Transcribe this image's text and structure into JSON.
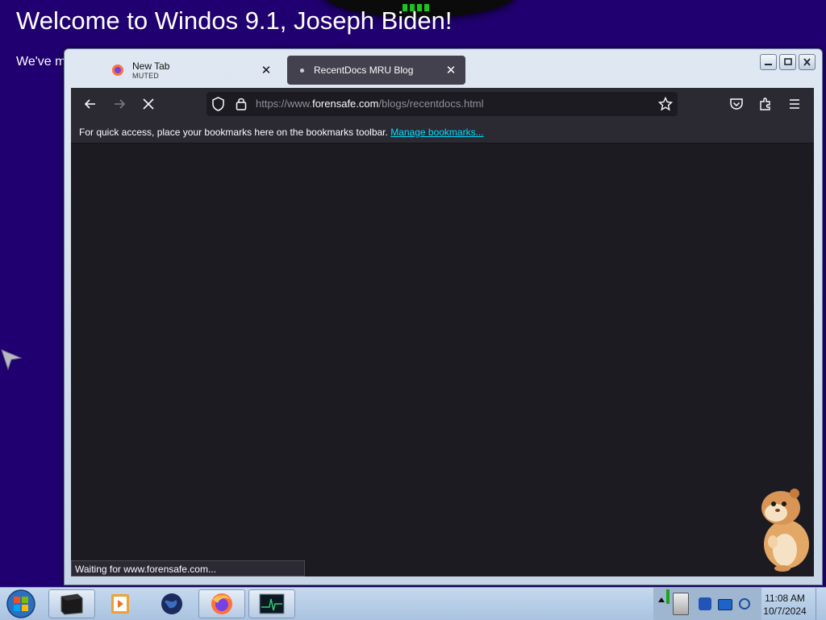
{
  "desktop": {
    "welcome_title": "Welcome to Windos 9.1, Joseph Biden!",
    "subtext": "We've m"
  },
  "browser": {
    "tabs": [
      {
        "title": "New Tab",
        "subtitle": "MUTED",
        "active": false
      },
      {
        "title": "RecentDocs MRU Blog",
        "active": true
      }
    ],
    "url_prefix": "https://www.",
    "url_host": "forensafe.com",
    "url_path": "/blogs/recentdocs.html",
    "bookmarks_message": "For quick access, place your bookmarks here on the bookmarks toolbar.",
    "manage_bookmarks_link": "Manage bookmarks...",
    "status_text": "Waiting for www.forensafe.com...",
    "icons": [
      "back-arrow-icon",
      "forward-arrow-icon",
      "stop-icon",
      "shield-icon",
      "lock-icon",
      "star-icon",
      "pocket-icon",
      "extensions-icon",
      "menu-icon"
    ]
  },
  "taskbar": {
    "apps": [
      "terminal-app",
      "media-player-app",
      "globe-browser-app",
      "firefox-app",
      "task-manager-app"
    ],
    "clock_time": "11:08 AM",
    "clock_date": "10/7/2024"
  },
  "colors": {
    "desktop_bg": "#200070",
    "browser_dark": "#1c1b22",
    "toolbar_dark": "#2b2a33",
    "link": "#00ddff"
  }
}
